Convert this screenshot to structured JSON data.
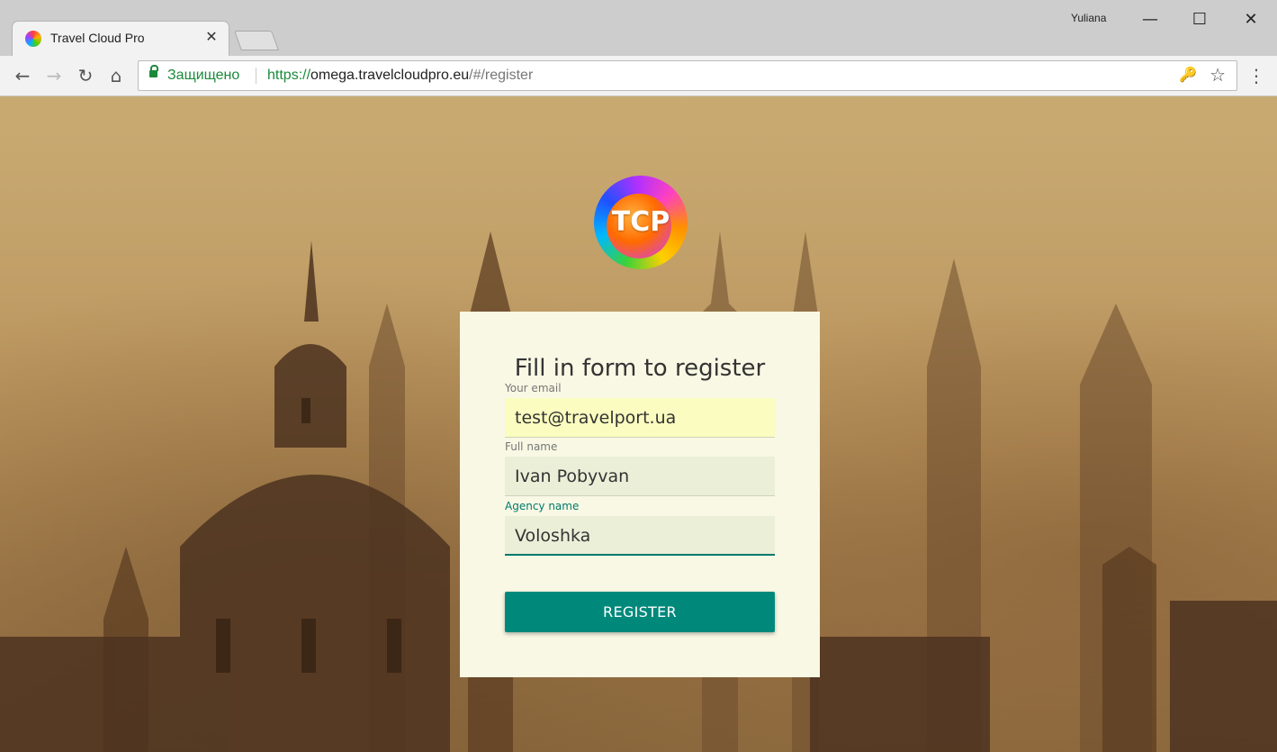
{
  "browser": {
    "tab_title": "Travel Cloud Pro",
    "tab_close": "✕",
    "profile_name": "Yuliana",
    "window_controls": {
      "minimize": "—",
      "maximize": "☐",
      "close": "✕"
    },
    "nav": {
      "back": "←",
      "forward": "→",
      "reload": "↻",
      "home": "⌂",
      "menu": "⋮"
    },
    "omnibox": {
      "secure_label": "Защищено",
      "url_scheme": "https://",
      "url_host": "omega.travelcloudpro.eu",
      "url_path": "/#/register",
      "key_icon": "🔑",
      "star_icon": "☆"
    }
  },
  "logo": {
    "text": "TCP"
  },
  "form": {
    "title": "Fill in form to register",
    "email": {
      "label": "Your email",
      "value": "test@travelport.ua"
    },
    "full_name": {
      "label": "Full name",
      "value": "Ivan Pobyvan"
    },
    "agency_name": {
      "label": "Agency name",
      "value": "Voloshka"
    },
    "submit_label": "REGISTER"
  },
  "colors": {
    "accent": "#00897b",
    "card_bg": "#f8f8e4",
    "secure_green": "#1a8a3a"
  }
}
